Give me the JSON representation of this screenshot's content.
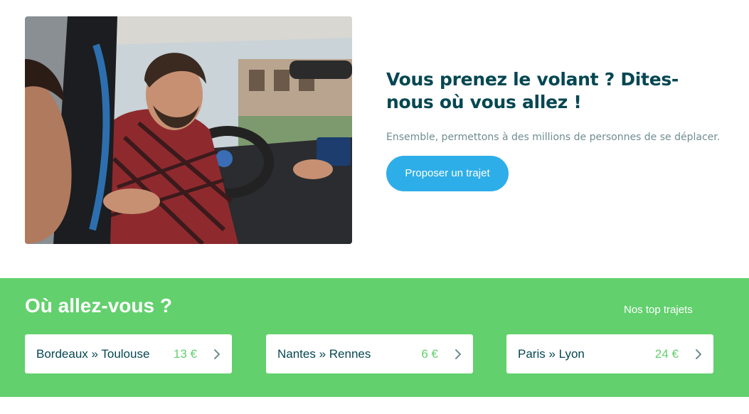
{
  "hero": {
    "title": "Vous prenez le volant ? Dites-nous où vous allez !",
    "subtitle": "Ensemble, permettons à des millions de personnes de se déplacer.",
    "cta_label": "Proposer un trajet",
    "button_color": "#2eaee8"
  },
  "destinations": {
    "title": "Où allez-vous ?",
    "top_trips_link": "Nos top trajets",
    "band_color": "#62d06d",
    "trips": [
      {
        "route": "Bordeaux » Toulouse",
        "price": "13 €"
      },
      {
        "route": "Nantes » Rennes",
        "price": "6 €"
      },
      {
        "route": "Paris » Lyon",
        "price": "24 €"
      }
    ]
  }
}
